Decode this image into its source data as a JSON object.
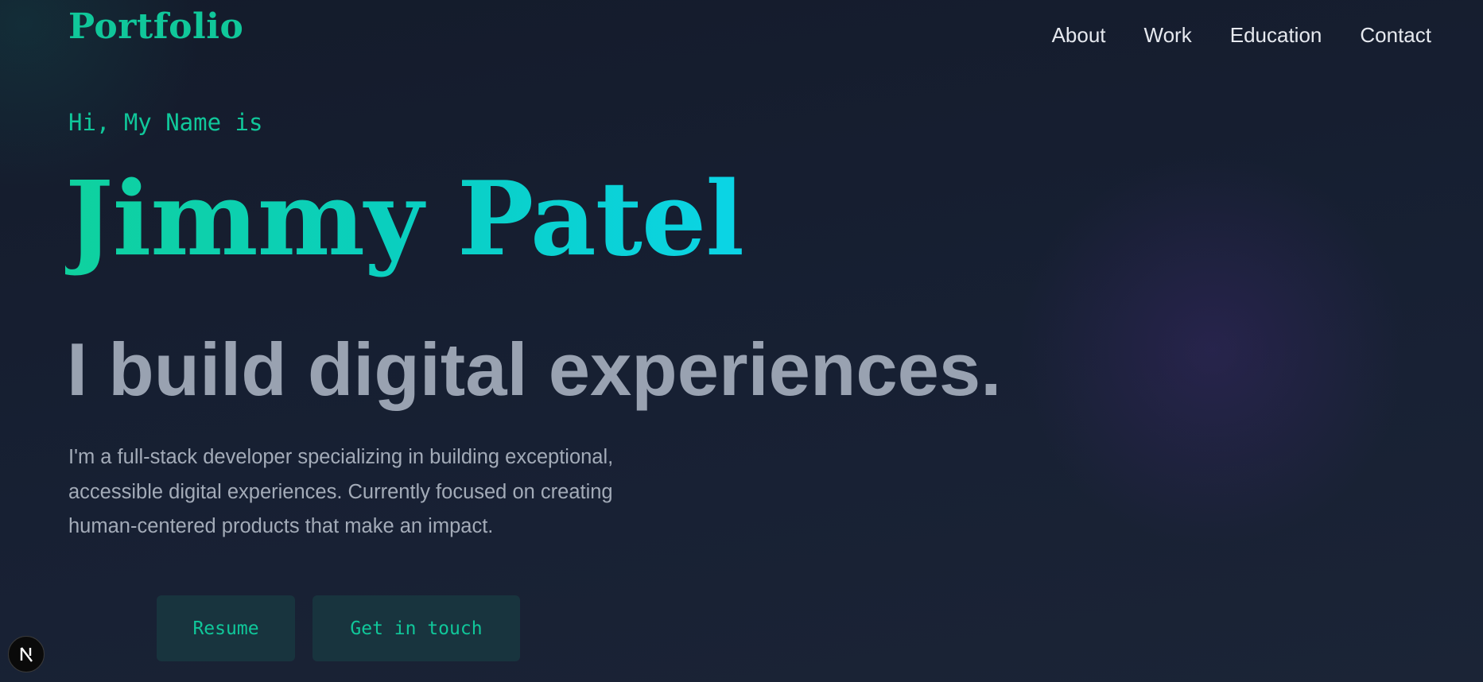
{
  "header": {
    "logo": "Portfolio",
    "nav": [
      "About",
      "Work",
      "Education",
      "Contact"
    ]
  },
  "hero": {
    "greeting": "Hi, My Name is",
    "name": "Jimmy Patel",
    "tagline": "I build digital experiences.",
    "intro": "I'm a full-stack developer specializing in building exceptional, accessible digital experiences. Currently focused on creating human-centered products that make an impact.",
    "buttons": {
      "resume": "Resume",
      "contact": "Get in touch"
    }
  },
  "dev_badge": {
    "icon": "nextjs-icon",
    "letter": "N"
  },
  "colors": {
    "accent": "#10c79a",
    "name_gradient_start": "#0fd19e",
    "name_gradient_end": "#0bd4e6",
    "background": "#172033",
    "tagline": "#99a2b1",
    "body_text": "#a3abb8",
    "button_bg": "#18343e"
  }
}
